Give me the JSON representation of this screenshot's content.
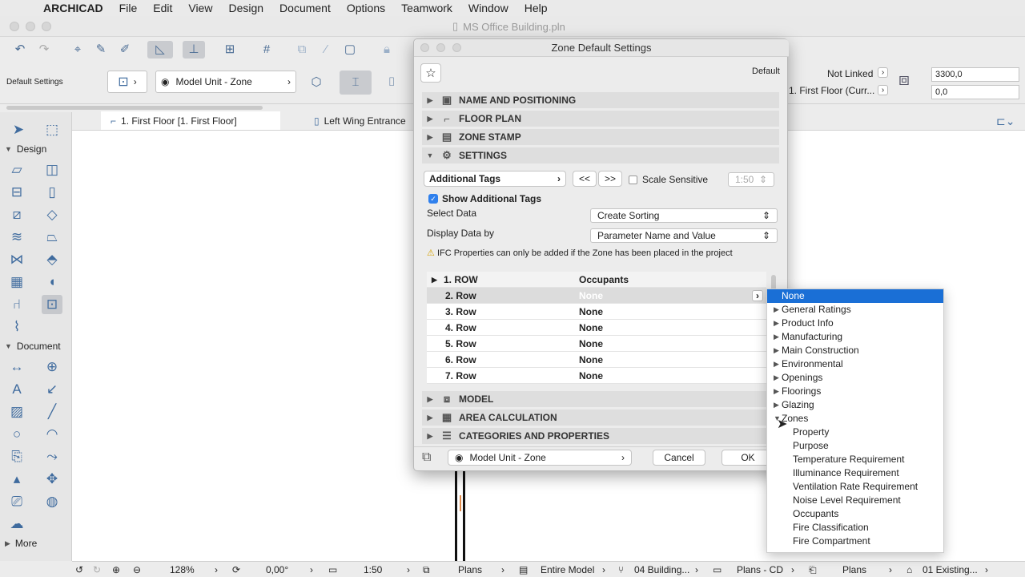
{
  "menubar": {
    "app": "ARCHICAD",
    "items": [
      "File",
      "Edit",
      "View",
      "Design",
      "Document",
      "Options",
      "Teamwork",
      "Window",
      "Help"
    ]
  },
  "window": {
    "title": "MS Office Building.pln"
  },
  "info": {
    "default_settings": "Default Settings",
    "zone_unit": "Model Unit - Zone",
    "not_linked": "Not Linked",
    "floor": "1. First Floor (Curr...",
    "value1": "3300,0",
    "value2": "0,0"
  },
  "tabs": [
    {
      "label": "1. First Floor [1. First Floor]"
    },
    {
      "label": "Left Wing Entrance"
    }
  ],
  "toolbox": {
    "design_label": "Design",
    "document_label": "Document",
    "more_label": "More"
  },
  "dialog": {
    "title": "Zone Default Settings",
    "default_label": "Default",
    "panels": [
      "NAME AND POSITIONING",
      "FLOOR PLAN",
      "ZONE STAMP",
      "SETTINGS"
    ],
    "panels_bottom": [
      "MODEL",
      "AREA CALCULATION",
      "CATEGORIES AND PROPERTIES"
    ],
    "additional_tags": "Additional Tags",
    "prev": "<<",
    "next": ">>",
    "scale_sensitive": "Scale Sensitive",
    "scale_value": "1:50",
    "show_tags": "Show Additional Tags",
    "select_data_label": "Select Data",
    "select_data_value": "Create Sorting",
    "display_by_label": "Display Data by",
    "display_by_value": "Parameter Name and Value",
    "warning": "IFC Properties can only be added if the Zone has been placed in the project",
    "rows": [
      {
        "name": "1. ROW",
        "value": "Occupants"
      },
      {
        "name": "2. Row",
        "value": "None"
      },
      {
        "name": "3. Row",
        "value": "None"
      },
      {
        "name": "4. Row",
        "value": "None"
      },
      {
        "name": "5. Row",
        "value": "None"
      },
      {
        "name": "6. Row",
        "value": "None"
      },
      {
        "name": "7. Row",
        "value": "None"
      }
    ],
    "footer_unit": "Model Unit - Zone",
    "cancel": "Cancel",
    "ok": "OK"
  },
  "dropdown": {
    "selected": "None",
    "groups": [
      "General Ratings",
      "Product Info",
      "Manufacturing",
      "Main Construction",
      "Environmental",
      "Openings",
      "Floorings",
      "Glazing",
      "Zones"
    ],
    "zone_items": [
      "Property",
      "Purpose",
      "Temperature Requirement",
      "Illuminance Requirement",
      "Ventilation Rate Requirement",
      "Noise Level Requirement",
      "Occupants",
      "Fire Classification",
      "Fire Compartment"
    ]
  },
  "status": {
    "zoom": "128%",
    "angle": "0,00°",
    "scale": "1:50",
    "layer": "Plans",
    "model": "Entire Model",
    "building": "04 Building...",
    "plans_cd": "Plans - CD",
    "plans2": "Plans",
    "existing": "01 Existing..."
  }
}
